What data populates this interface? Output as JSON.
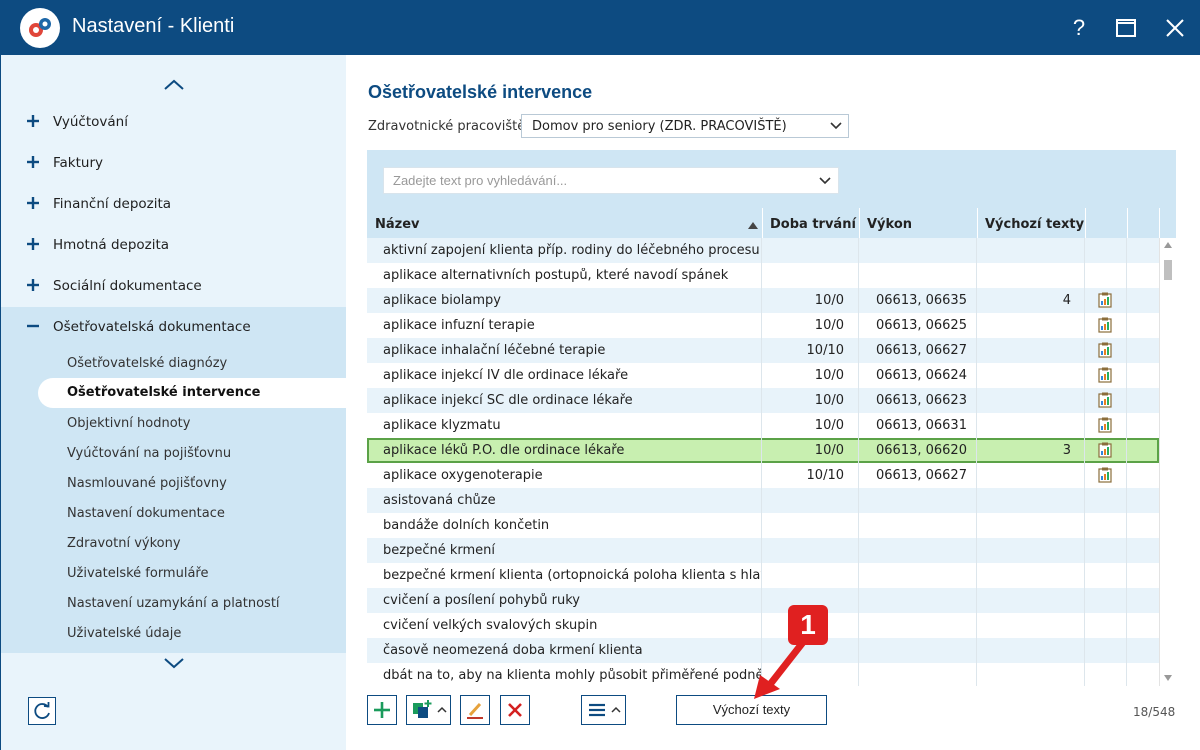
{
  "window": {
    "title": "Nastavení - Klienti",
    "help_label": "?",
    "accent_color": "#0d4b81"
  },
  "sidebar": {
    "items": [
      {
        "label": "Vyúčtování",
        "expanded": false
      },
      {
        "label": "Faktury",
        "expanded": false
      },
      {
        "label": "Finanční depozita",
        "expanded": false
      },
      {
        "label": "Hmotná depozita",
        "expanded": false
      },
      {
        "label": "Sociální dokumentace",
        "expanded": false
      },
      {
        "label": "Ošetřovatelská dokumentace",
        "expanded": true
      }
    ],
    "subitems": [
      "Ošetřovatelské diagnózy",
      "Ošetřovatelské intervence",
      "Objektivní hodnoty",
      "Vyúčtování na pojišťovnu",
      "Nasmlouvané pojišťovny",
      "Nastavení dokumentace",
      "Zdravotní výkony",
      "Uživatelské formuláře",
      "Nastavení uzamykání a platností",
      "Uživatelské údaje"
    ],
    "active_subitem": "Ošetřovatelské intervence"
  },
  "main": {
    "title": "Ošetřovatelské intervence",
    "workplace_label": "Zdravotnické pracoviště:",
    "workplace_value": "Domov pro seniory (ZDR. PRACOVIŠTĚ)",
    "search_placeholder": "Zadejte text pro vyhledávání...",
    "columns": [
      "Název",
      "Doba trvání",
      "Výkon",
      "Výchozí texty"
    ],
    "rows": [
      {
        "name": "aktivní zapojení klienta příp. rodiny do léčebného procesu",
        "duration": "",
        "performance": "",
        "defaults": "",
        "icon": false
      },
      {
        "name": "aplikace alternativních postupů, které navodí spánek",
        "duration": "",
        "performance": "",
        "defaults": "",
        "icon": false
      },
      {
        "name": "aplikace biolampy",
        "duration": "10/0",
        "performance": "06613, 06635",
        "defaults": "4",
        "icon": true
      },
      {
        "name": "aplikace infuzní terapie",
        "duration": "10/0",
        "performance": "06613, 06625",
        "defaults": "",
        "icon": true
      },
      {
        "name": "aplikace inhalační léčebné terapie",
        "duration": "10/10",
        "performance": "06613, 06627",
        "defaults": "",
        "icon": true
      },
      {
        "name": "aplikace injekcí IV dle ordinace lékaře",
        "duration": "10/0",
        "performance": "06613, 06624",
        "defaults": "",
        "icon": true
      },
      {
        "name": "aplikace injekcí SC dle ordinace lékaře",
        "duration": "10/0",
        "performance": "06613, 06623",
        "defaults": "",
        "icon": true
      },
      {
        "name": "aplikace klyzmatu",
        "duration": "10/0",
        "performance": "06613, 06631",
        "defaults": "",
        "icon": true
      },
      {
        "name": "aplikace léků P.O. dle ordinace lékaře",
        "duration": "10/0",
        "performance": "06613, 06620",
        "defaults": "3",
        "icon": true,
        "selected": true
      },
      {
        "name": "aplikace oxygenoterapie",
        "duration": "10/10",
        "performance": "06613, 06627",
        "defaults": "",
        "icon": true
      },
      {
        "name": "asistovaná chůze",
        "duration": "",
        "performance": "",
        "defaults": "",
        "icon": false
      },
      {
        "name": "bandáže dolních končetin",
        "duration": "",
        "performance": "",
        "defaults": "",
        "icon": false
      },
      {
        "name": "bezpečné krmení",
        "duration": "",
        "performance": "",
        "defaults": "",
        "icon": false
      },
      {
        "name": "bezpečné krmení klienta (ortopnoická poloha klienta s hlav...",
        "duration": "",
        "performance": "",
        "defaults": "",
        "icon": false
      },
      {
        "name": "cvičení a posílení pohybů ruky",
        "duration": "",
        "performance": "",
        "defaults": "",
        "icon": false
      },
      {
        "name": "cvičení velkých svalových skupin",
        "duration": "",
        "performance": "",
        "defaults": "",
        "icon": false
      },
      {
        "name": "časově neomezená doba krmení klienta",
        "duration": "",
        "performance": "",
        "defaults": "",
        "icon": false
      },
      {
        "name": "dbát na to, aby na klienta mohly působit přiměřené podnět...",
        "duration": "",
        "performance": "",
        "defaults": "",
        "icon": false
      }
    ],
    "defaults_button": "Výchozí texty",
    "counter": "18/548",
    "annotation_number": "1",
    "colors": {
      "selected_row": "#c8efb0",
      "selected_border": "#5ba247",
      "alt_row": "#e8f3fa",
      "annotation": "#e02020"
    }
  }
}
